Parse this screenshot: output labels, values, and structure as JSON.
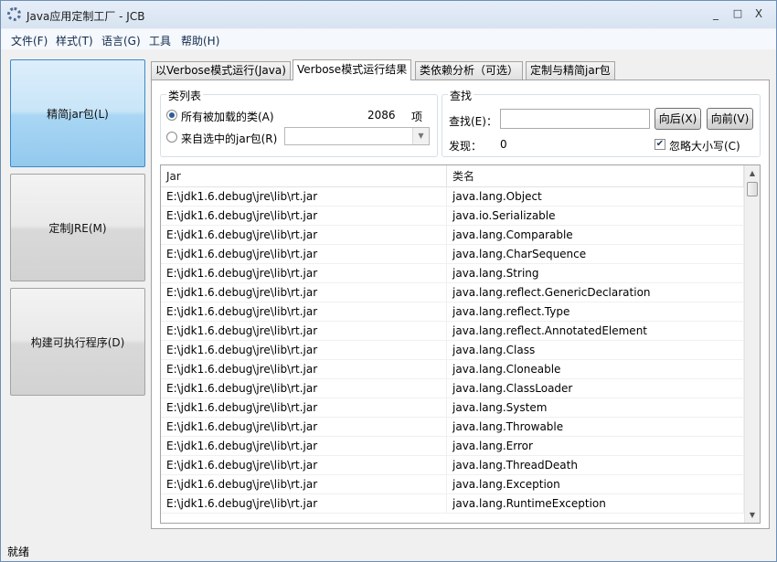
{
  "window": {
    "title": "Java应用定制工厂 - JCB",
    "controls": {
      "minimize": "_",
      "maximize": "□",
      "close": "X"
    }
  },
  "menu": [
    "文件(F)",
    "样式(T)",
    "语言(G)",
    "工具",
    "帮助(H)"
  ],
  "sidebar": {
    "buttons": [
      "精简jar包(L)",
      "定制JRE(M)",
      "构建可执行程序(D)"
    ],
    "active_index": 0
  },
  "tabs": {
    "labels": [
      "以Verbose模式运行(Java)",
      "Verbose模式运行结果",
      "类依赖分析（可选）",
      "定制与精简jar包"
    ],
    "active_index": 1
  },
  "class_list": {
    "group_title": "类列表",
    "all_loaded_label": "所有被加载的类(A)",
    "from_jar_label": "来自选中的jar包(R)",
    "count": "2086",
    "count_unit": "项",
    "jar_select_value": ""
  },
  "search": {
    "group_title": "查找",
    "find_label": "查找(E)：",
    "find_value": "",
    "back_button": "向后(X)",
    "forward_button": "向前(V)",
    "found_label": "发现：",
    "found_count": "0",
    "ignore_case_label": "忽略大小写(C)",
    "ignore_case_checked": true
  },
  "table": {
    "headers": [
      "Jar",
      "类名"
    ],
    "rows": [
      [
        "E:\\jdk1.6.debug\\jre\\lib\\rt.jar",
        "java.lang.Object"
      ],
      [
        "E:\\jdk1.6.debug\\jre\\lib\\rt.jar",
        "java.io.Serializable"
      ],
      [
        "E:\\jdk1.6.debug\\jre\\lib\\rt.jar",
        "java.lang.Comparable"
      ],
      [
        "E:\\jdk1.6.debug\\jre\\lib\\rt.jar",
        "java.lang.CharSequence"
      ],
      [
        "E:\\jdk1.6.debug\\jre\\lib\\rt.jar",
        "java.lang.String"
      ],
      [
        "E:\\jdk1.6.debug\\jre\\lib\\rt.jar",
        "java.lang.reflect.GenericDeclaration"
      ],
      [
        "E:\\jdk1.6.debug\\jre\\lib\\rt.jar",
        "java.lang.reflect.Type"
      ],
      [
        "E:\\jdk1.6.debug\\jre\\lib\\rt.jar",
        "java.lang.reflect.AnnotatedElement"
      ],
      [
        "E:\\jdk1.6.debug\\jre\\lib\\rt.jar",
        "java.lang.Class"
      ],
      [
        "E:\\jdk1.6.debug\\jre\\lib\\rt.jar",
        "java.lang.Cloneable"
      ],
      [
        "E:\\jdk1.6.debug\\jre\\lib\\rt.jar",
        "java.lang.ClassLoader"
      ],
      [
        "E:\\jdk1.6.debug\\jre\\lib\\rt.jar",
        "java.lang.System"
      ],
      [
        "E:\\jdk1.6.debug\\jre\\lib\\rt.jar",
        "java.lang.Throwable"
      ],
      [
        "E:\\jdk1.6.debug\\jre\\lib\\rt.jar",
        "java.lang.Error"
      ],
      [
        "E:\\jdk1.6.debug\\jre\\lib\\rt.jar",
        "java.lang.ThreadDeath"
      ],
      [
        "E:\\jdk1.6.debug\\jre\\lib\\rt.jar",
        "java.lang.Exception"
      ],
      [
        "E:\\jdk1.6.debug\\jre\\lib\\rt.jar",
        "java.lang.RuntimeException"
      ]
    ]
  },
  "status": "就绪"
}
